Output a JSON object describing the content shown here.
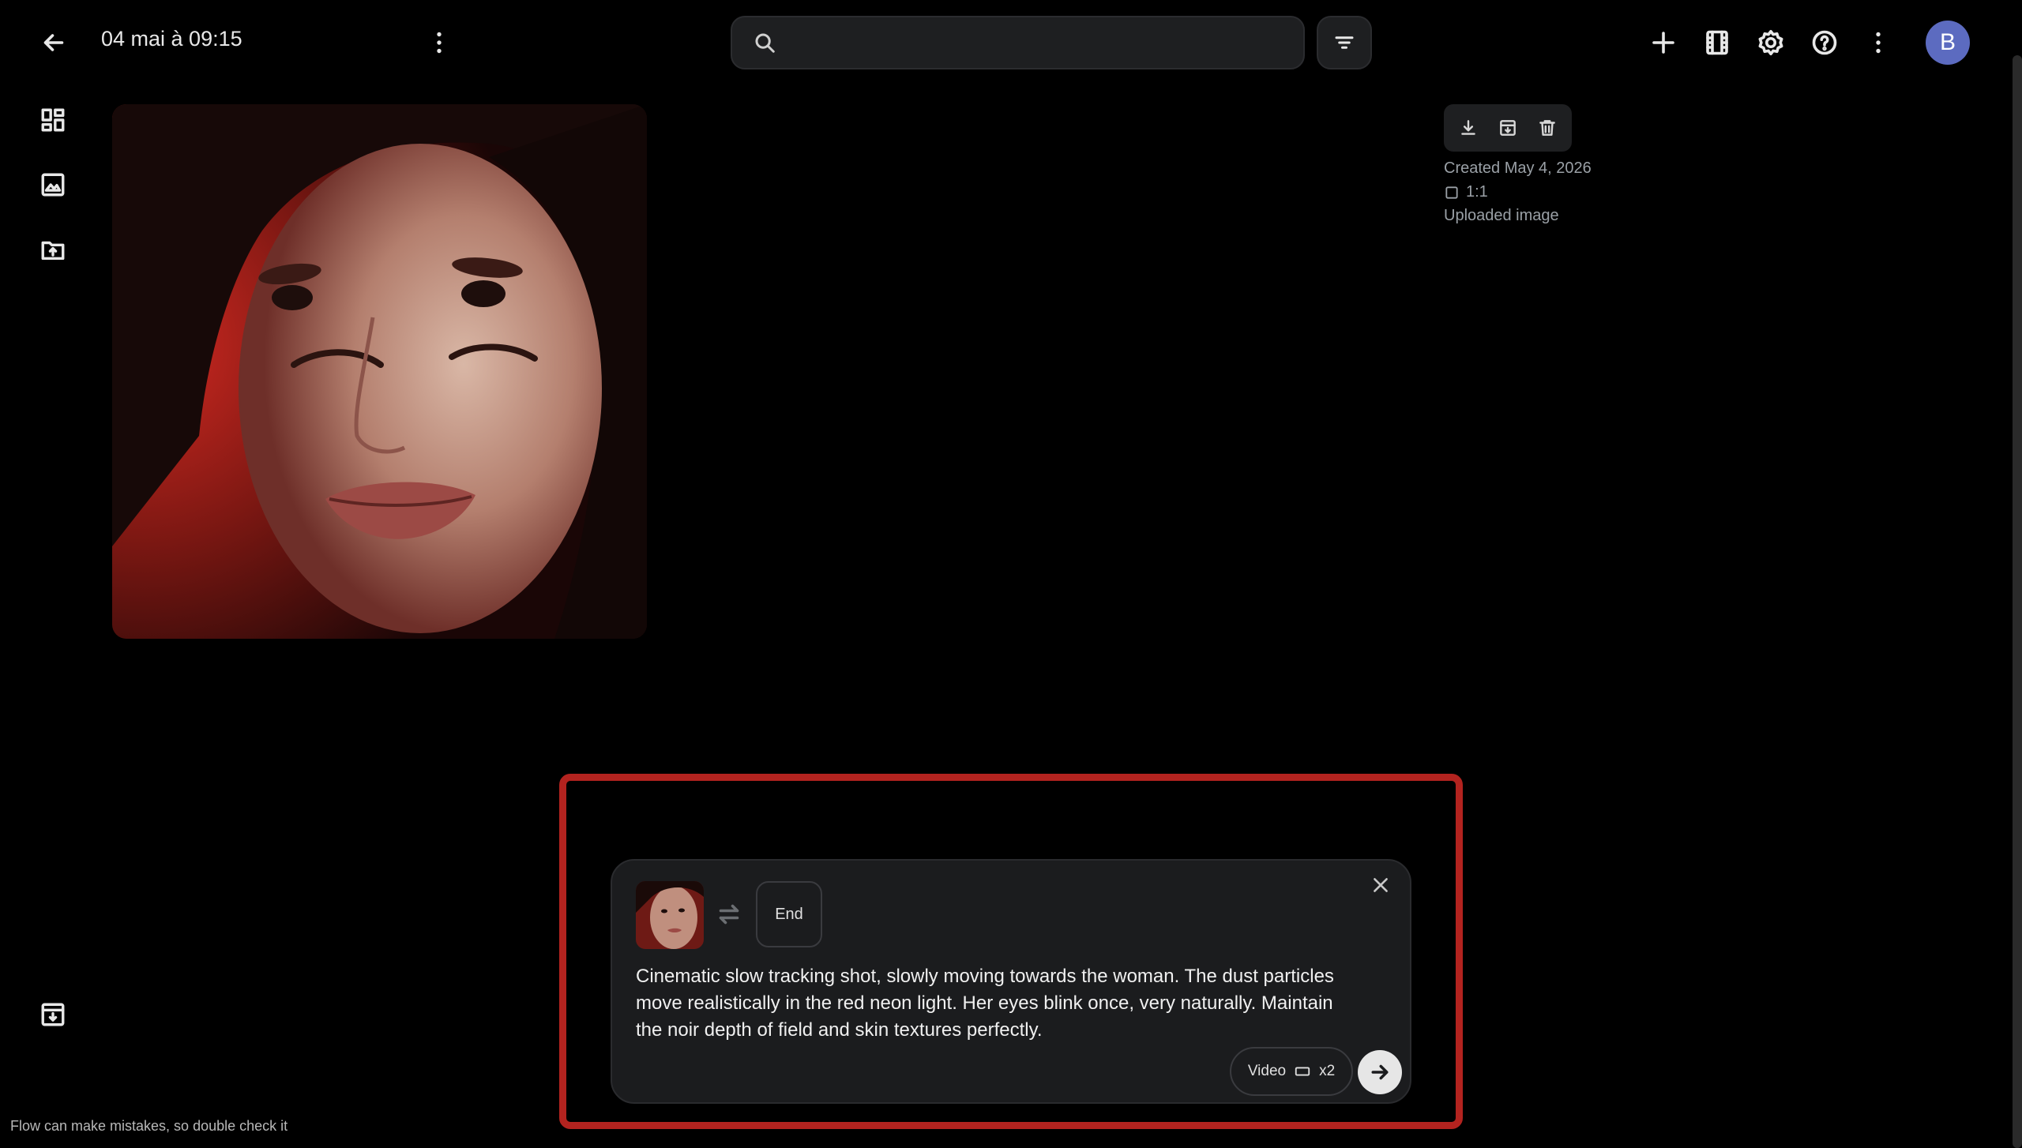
{
  "header": {
    "title": "04 mai à 09:15",
    "search_placeholder": "",
    "avatar_letter": "B"
  },
  "icons": {
    "back": "arrow-left-icon",
    "more_title": "more-vertical-icon",
    "search": "search-icon",
    "filter": "filter-icon",
    "add": "plus-icon",
    "film": "film-icon",
    "settings": "gear-icon",
    "help": "help-icon",
    "more_top": "more-vertical-icon",
    "sidebar": [
      "grid-icon",
      "image-icon",
      "folder-upload-icon"
    ],
    "sidebar_bottom": "archive-download-icon"
  },
  "details": {
    "created": "Created May 4, 2026",
    "aspect": "1:1",
    "source": "Uploaded image",
    "toolbar": [
      "download-icon",
      "archive-icon",
      "trash-icon"
    ]
  },
  "composer": {
    "end_label": "End",
    "prompt": "Cinematic slow tracking shot, slowly moving towards the woman. The dust particles move realistically in the red neon light. Her eyes blink once, very naturally. Maintain the noir depth of field and skin textures perfectly.",
    "mode_label": "Video",
    "count_label": "x2"
  },
  "footer": {
    "note": "Flow can make mistakes, so double check it"
  },
  "colors": {
    "background": "#000000",
    "surface": "#1b1c1e",
    "avatar": "#5c6bc0",
    "highlight": "#b3231f"
  }
}
